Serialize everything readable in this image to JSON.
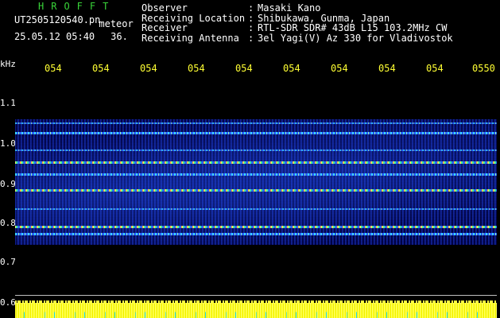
{
  "header": {
    "brand": "HROFFT",
    "filename": "UT2505120540.pn",
    "meteor_label": "meteor",
    "date_time": "25.05.12 05:40",
    "count": "36."
  },
  "info": [
    {
      "key": "Observer",
      "sep": ":",
      "value": "Masaki Kano"
    },
    {
      "key": "Receiving Location",
      "sep": ":",
      "value": "Shibukawa, Gunma, Japan"
    },
    {
      "key": "Receiver",
      "sep": ":",
      "value": "RTL-SDR SDR# 43dB L15 103.2MHz CW"
    },
    {
      "key": "Receiving Antenna",
      "sep": ":",
      "value": "3el Yagi(V) Az 330 for Vladivostok"
    }
  ],
  "y_axis": {
    "unit": "kHz",
    "labels": [
      "1.1",
      "1.0",
      "0.9",
      "0.8",
      "0.7",
      "0.6"
    ]
  },
  "x_axis": {
    "ticks": [
      "054",
      "054",
      "054",
      "054",
      "054",
      "054",
      "054",
      "054",
      "054",
      "0550"
    ]
  },
  "colors": {
    "brand": "#39d439",
    "tick_label": "#ffff33",
    "power_trace": "#ffff2a",
    "spectrum_low": "#1c55ff",
    "spectrum_high": "#ffe86a"
  }
}
